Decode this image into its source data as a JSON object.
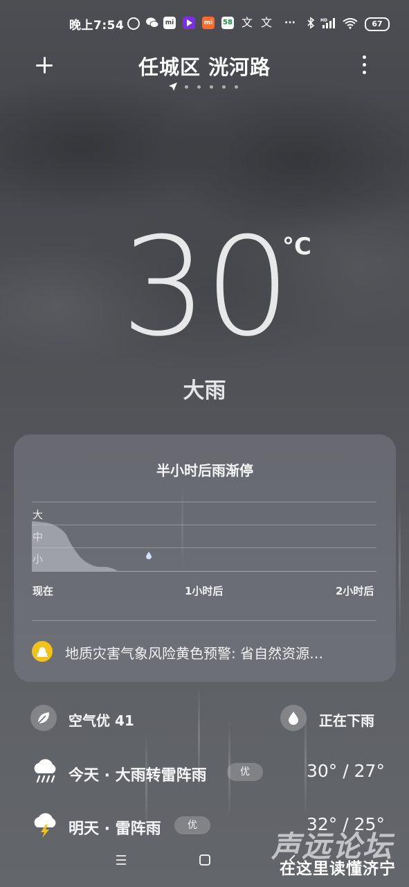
{
  "status_bar": {
    "time": "晚上7:54",
    "battery": "67",
    "icons": [
      "netease-icon",
      "wechat-icon",
      "mi-app-icon",
      "video-app-icon",
      "mi-store-icon",
      "58-app-icon",
      "translate-icon",
      "translate-icon",
      "more-dots-icon",
      "bluetooth-icon",
      "signal-hd-icon",
      "wifi-icon",
      "battery-icon"
    ]
  },
  "header": {
    "location": "任城区 洸河路",
    "page_count": 6,
    "current_page": 0
  },
  "current": {
    "temperature": "30",
    "unit": "°C",
    "condition": "大雨"
  },
  "rain_card": {
    "title": "半小时后雨渐停",
    "levels": [
      "大",
      "中",
      "小"
    ],
    "x_labels": [
      "现在",
      "1小时后",
      "2小时后"
    ],
    "alert": "地质灾害气象风险黄色预警: 省自然资源…"
  },
  "air": {
    "label": "空气优 41"
  },
  "precip": {
    "label": "正在下雨"
  },
  "forecast": [
    {
      "day": "今天 · 大雨转雷阵雨",
      "aqi": "优",
      "range": "30° / 27°",
      "icon": "heavy-rain-icon"
    },
    {
      "day": "明天 · 雷阵雨",
      "aqi": "优",
      "range": "32° / 25°",
      "icon": "thunderstorm-icon"
    }
  ],
  "watermark": {
    "main": "声远论坛",
    "sub": "在这里读懂济宁"
  },
  "colors": {
    "alert_yellow": "#f2c21a",
    "background": "#4d4f54"
  }
}
